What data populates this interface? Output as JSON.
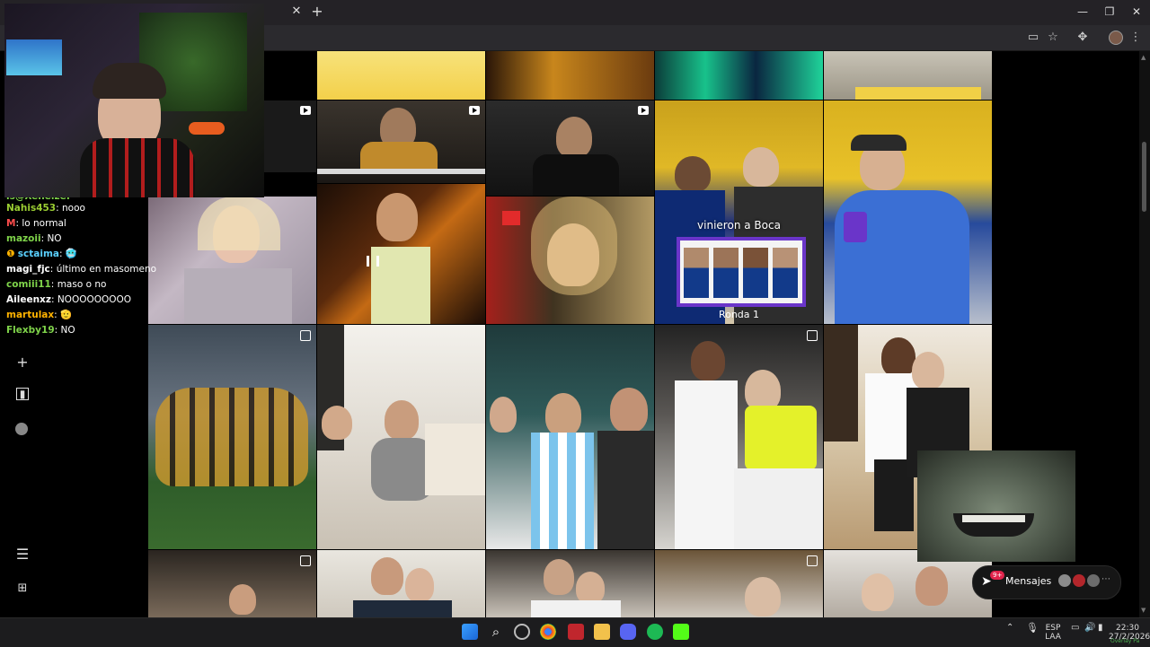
{
  "browser": {
    "tab_close": "✕",
    "new_tab": "+",
    "window_controls": [
      "—",
      "❐",
      "✕"
    ]
  },
  "reel": {
    "text_overlay": "vinieron a Boca",
    "caption": "Ronda 1"
  },
  "chat": {
    "messages": [
      {
        "user": "Nahis453",
        "text": "nooo",
        "color": "#9acd32"
      },
      {
        "user": "M",
        "text": "lo normal",
        "color": "#ff4d4d"
      },
      {
        "user": "mazoii",
        "text": "NO",
        "color": "#7fd44a"
      },
      {
        "user": "sctaima",
        "text": "",
        "color": "#5ad1ff"
      },
      {
        "user": "magi_fjc",
        "text": "último en masomeno",
        "color": "#ffffff"
      },
      {
        "user": "comiii11",
        "text": "maso o no",
        "color": "#7fd44a"
      },
      {
        "user": "Aileenxz",
        "text": "NOOOOOOOOO",
        "color": "#ffffff"
      },
      {
        "user": "martulax",
        "text": "",
        "color": "#ffb300"
      },
      {
        "user": "Flexby19",
        "text": "NO",
        "color": "#7fd44a"
      }
    ],
    "top_partial": "is@Xeneize:"
  },
  "messages_widget": {
    "label": "Mensajes",
    "badge": "9+"
  },
  "taskbar": {
    "lang_top": "ESP",
    "lang_bottom": "LAA",
    "time": "22:30",
    "date": "27/2/2026",
    "overlay_text": "Overlay Pa"
  },
  "colors": {
    "accent": "#e0244c",
    "boca_yellow": "#f3c21a",
    "boca_blue": "#0e2a73",
    "purple_frame": "#6a35c9"
  }
}
